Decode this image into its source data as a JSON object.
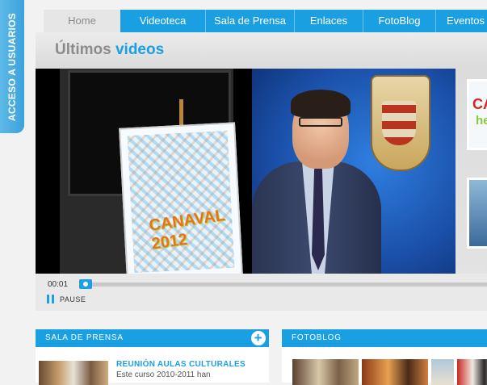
{
  "side_tab": {
    "label": "ACCESO A USUARIOS"
  },
  "nav": {
    "tabs": [
      {
        "label": "Home",
        "active": true
      },
      {
        "label": "Videoteca"
      },
      {
        "label": "Sala de Prensa"
      },
      {
        "label": "Enlaces"
      },
      {
        "label": "FotoBlog"
      },
      {
        "label": "Eventos"
      }
    ]
  },
  "main": {
    "title_prefix": "Últimos",
    "title_highlight": "videos",
    "player": {
      "time": "00:01",
      "progress": 0.0,
      "pause_label": "PAUSE",
      "poster_logo": "CANAVAL 2012"
    },
    "thumbnails": [
      {
        "text_top": "CA",
        "text_bottom": "he"
      },
      {
        "text_top": ""
      }
    ]
  },
  "sala_prensa": {
    "heading": "SALA DE PRENSA",
    "add_icon": "plus-icon",
    "news": {
      "title": "REUNIÓN AULAS CULTURALES",
      "text": "Este curso 2010-2011 han"
    }
  },
  "fotoblog": {
    "heading": "FOTOBLOG"
  },
  "colors": {
    "accent": "#1aa0e2",
    "title_gray": "#8c8c8c",
    "side_tab": "#3aa2dc"
  }
}
